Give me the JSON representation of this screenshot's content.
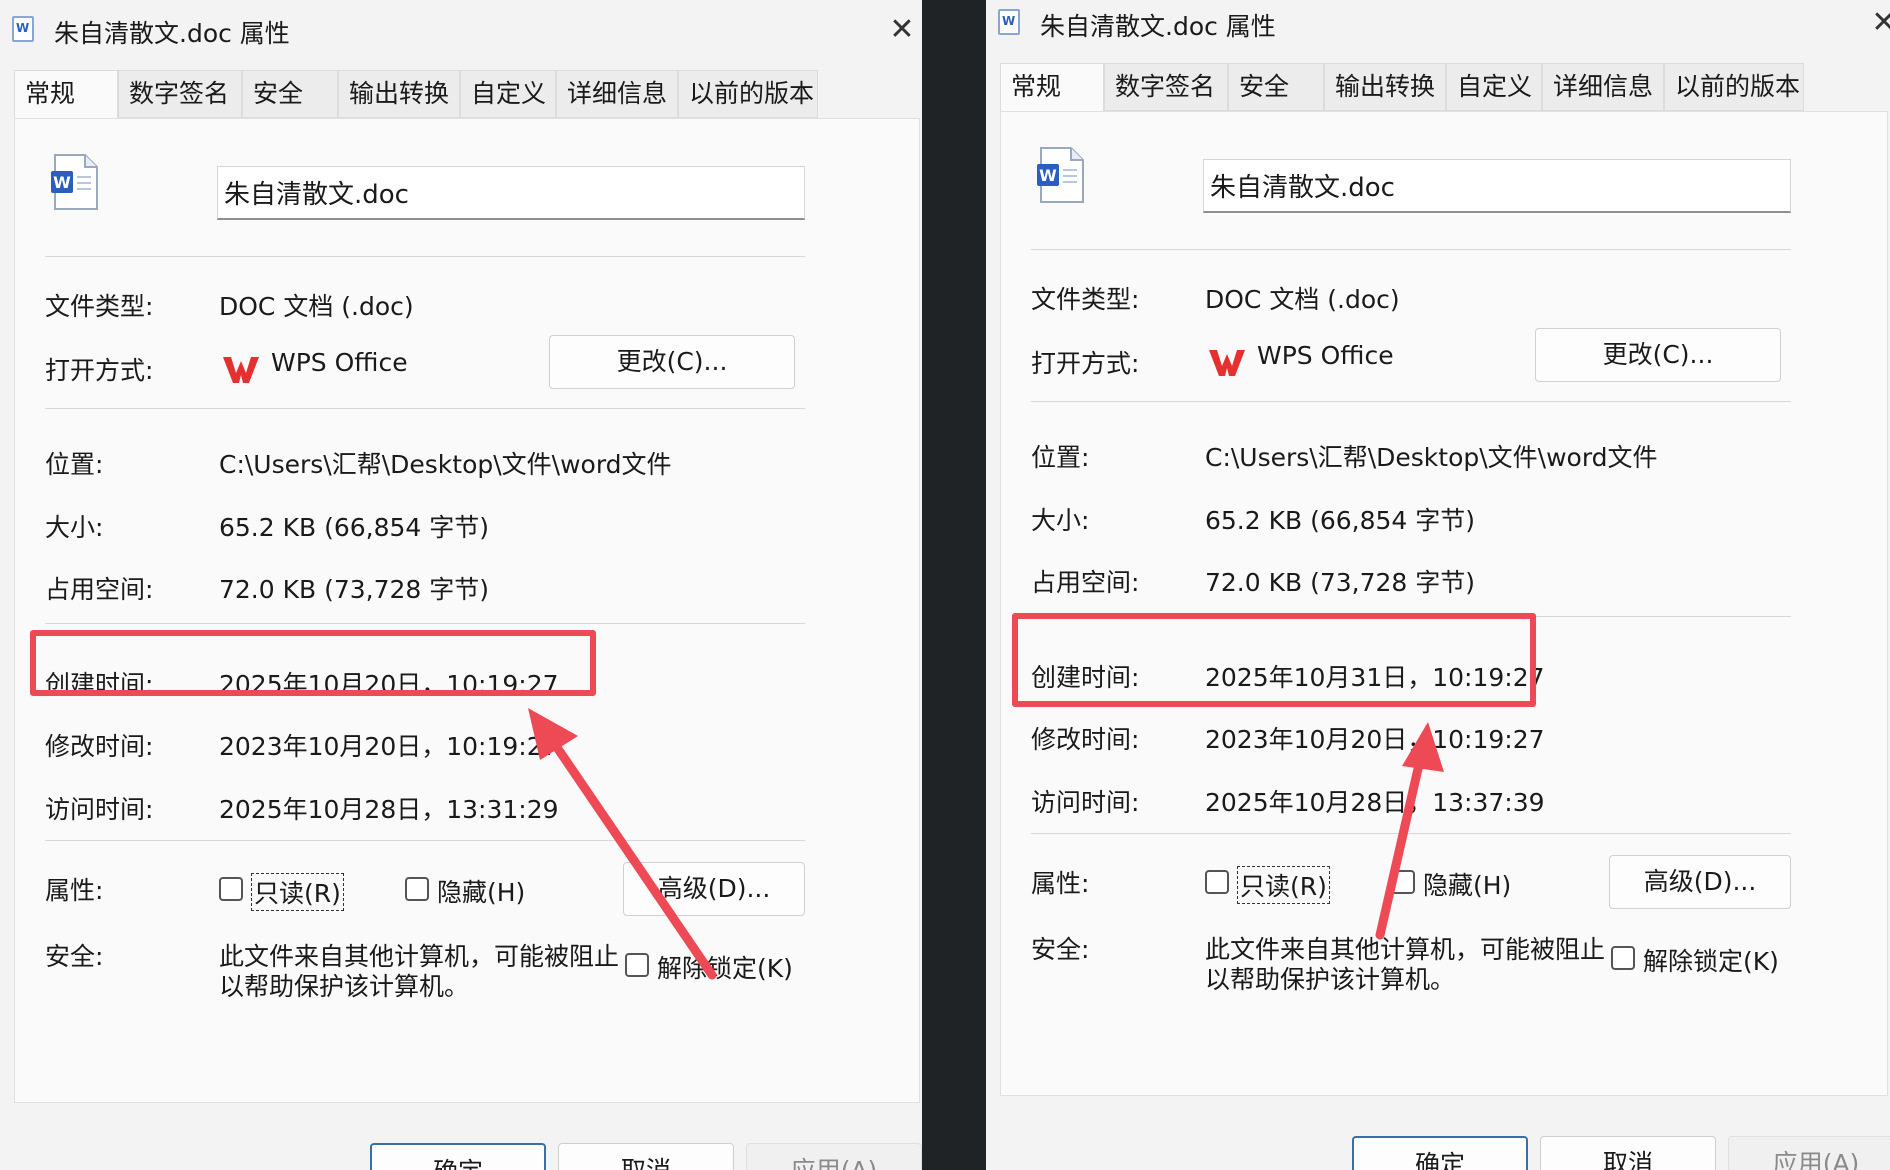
{
  "dialogs": [
    {
      "title": "朱自清散文.doc 属性",
      "close_glyph": "✕",
      "title_icon_letter": "W",
      "tabs": [
        "常规",
        "数字签名",
        "安全",
        "输出转换",
        "自定义",
        "详细信息",
        "以前的版本"
      ],
      "file_name": "朱自清散文.doc",
      "file_type_label": "文件类型:",
      "file_type_value": "DOC 文档 (.doc)",
      "open_with_label": "打开方式:",
      "open_with_value": "WPS Office",
      "change_button": "更改(C)...",
      "location_label": "位置:",
      "location_value": "C:\\Users\\汇帮\\Desktop\\文件\\word文件",
      "size_label": "大小:",
      "size_value": "65.2 KB (66,854 字节)",
      "disk_size_label": "占用空间:",
      "disk_size_value": "72.0 KB (73,728 字节)",
      "created_label": "创建时间:",
      "created_value": "2025年10月20日，10:19:27",
      "modified_label": "修改时间:",
      "modified_value": "2023年10月20日，10:19:27",
      "accessed_label": "访问时间:",
      "accessed_value": "2025年10月28日，13:31:29",
      "attributes_label": "属性:",
      "readonly_label": "只读(R)",
      "hidden_label": "隐藏(H)",
      "advanced_button": "高级(D)...",
      "security_label": "安全:",
      "security_line1": "此文件来自其他计算机，可能被阻止",
      "security_line2": "以帮助保护该计算机。",
      "unblock_label": "解除锁定(K)",
      "ok_button": "确定",
      "cancel_button": "取消",
      "apply_button": "应用(A)"
    },
    {
      "title": "朱自清散文.doc 属性",
      "close_glyph": "✕",
      "title_icon_letter": "W",
      "tabs": [
        "常规",
        "数字签名",
        "安全",
        "输出转换",
        "自定义",
        "详细信息",
        "以前的版本"
      ],
      "file_name": "朱自清散文.doc",
      "file_type_label": "文件类型:",
      "file_type_value": "DOC 文档 (.doc)",
      "open_with_label": "打开方式:",
      "open_with_value": "WPS Office",
      "change_button": "更改(C)...",
      "location_label": "位置:",
      "location_value": "C:\\Users\\汇帮\\Desktop\\文件\\word文件",
      "size_label": "大小:",
      "size_value": "65.2 KB (66,854 字节)",
      "disk_size_label": "占用空间:",
      "disk_size_value": "72.0 KB (73,728 字节)",
      "created_label": "创建时间:",
      "created_value": "2025年10月31日，10:19:27",
      "modified_label": "修改时间:",
      "modified_value": "2023年10月20日，10:19:27",
      "accessed_label": "访问时间:",
      "accessed_value": "2025年10月28日，13:37:39",
      "attributes_label": "属性:",
      "readonly_label": "只读(R)",
      "hidden_label": "隐藏(H)",
      "advanced_button": "高级(D)...",
      "security_label": "安全:",
      "security_line1": "此文件来自其他计算机，可能被阻止",
      "security_line2": "以帮助保护该计算机。",
      "unblock_label": "解除锁定(K)",
      "ok_button": "确定",
      "cancel_button": "取消",
      "apply_button": "应用(A)"
    }
  ],
  "colors": {
    "highlight_red": "#ee4a55",
    "wps_red": "#e5302f",
    "word_blue": "#2b5fbf",
    "dialog_bg": "#f3f3f3",
    "background_dark": "#1f2326"
  },
  "icons": {
    "title_icon": "word-document-icon",
    "file_icon": "word-document-icon",
    "app_icon": "wps-logo-icon",
    "close_icon": "close-icon",
    "annotation": "red-arrow"
  }
}
